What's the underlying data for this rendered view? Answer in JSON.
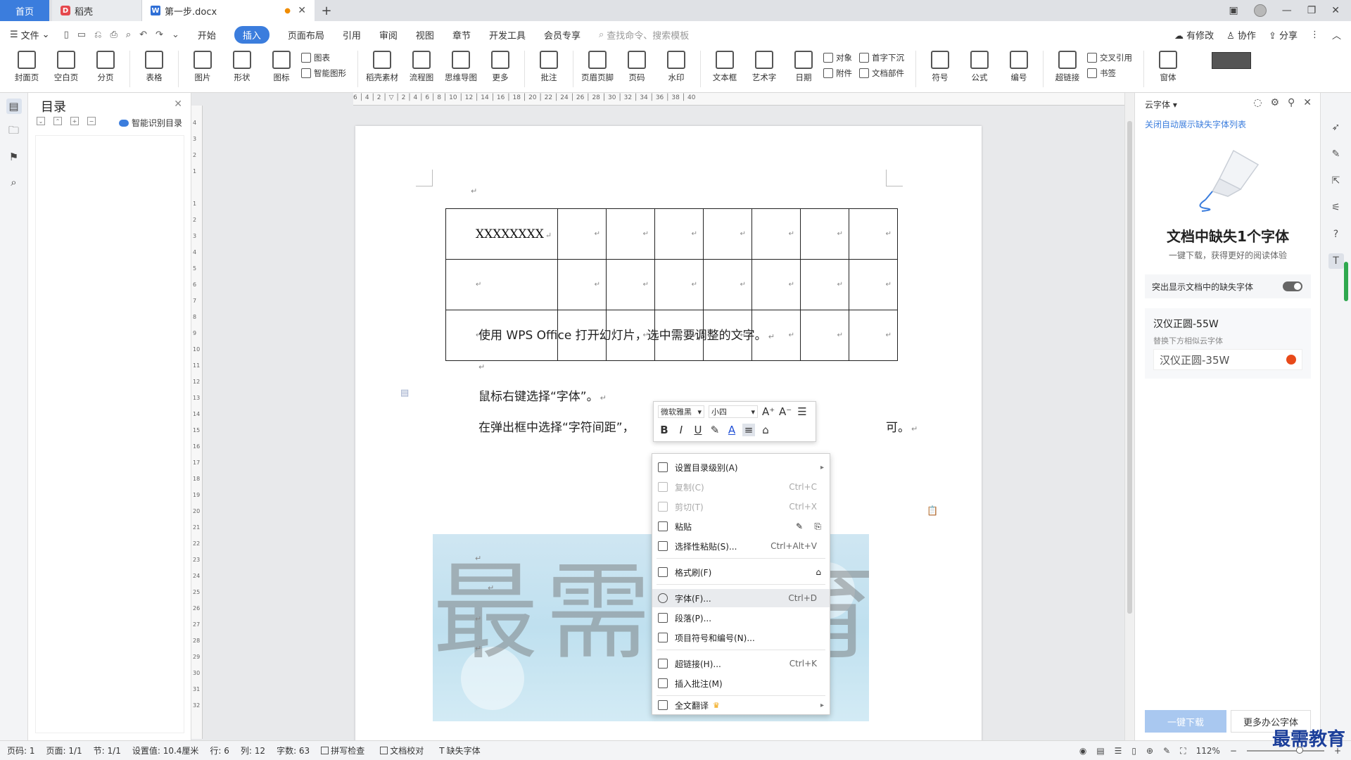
{
  "titlebar": {
    "tab_home": "首页",
    "tab_daoke": "稻壳",
    "tab_doc": "第一步.docx",
    "tab_add": "+"
  },
  "menubar": {
    "file": "文件",
    "items": [
      "开始",
      "插入",
      "页面布局",
      "引用",
      "审阅",
      "视图",
      "章节",
      "开发工具",
      "会员专享"
    ],
    "active_index": 1,
    "search": "查找命令、搜索模板",
    "right": [
      "有修改",
      "协作",
      "分享"
    ]
  },
  "ribbon": {
    "big": [
      {
        "label": "封面页"
      },
      {
        "label": "空白页"
      },
      {
        "label": "分页"
      },
      {
        "label": "表格"
      },
      {
        "label": "图片"
      },
      {
        "label": "形状"
      },
      {
        "label": "图标"
      }
    ],
    "small_a": [
      "图表",
      "智能图形"
    ],
    "big2": [
      {
        "label": "稻壳素材"
      },
      {
        "label": "流程图"
      },
      {
        "label": "思维导图"
      },
      {
        "label": "更多"
      },
      {
        "label": "批注"
      },
      {
        "label": "页眉页脚"
      },
      {
        "label": "页码"
      },
      {
        "label": "水印"
      },
      {
        "label": "文本框"
      },
      {
        "label": "艺术字"
      },
      {
        "label": "日期"
      }
    ],
    "small_b": [
      "对象",
      "附件"
    ],
    "small_c": [
      "首字下沉",
      "文档部件"
    ],
    "big3": [
      {
        "label": "符号"
      },
      {
        "label": "公式"
      },
      {
        "label": "编号"
      },
      {
        "label": "超链接"
      }
    ],
    "small_d": [
      "交叉引用",
      "书签"
    ],
    "big4": [
      {
        "label": "窗体"
      }
    ]
  },
  "toc": {
    "title": "目录",
    "smart": "智能识别目录"
  },
  "ruler": {
    "h": "6 │ 4 │ 2 │ ▽ │ 2 │ 4 │ 6 │ 8 │ 10 │ 12 │ 14 │ 16 │ 18 │ 20 │ 22 │ 24 │ 26 │ 28 │ 30 │ 32 │ 34 │ 36 │ 38 │ 40",
    "v": [
      "4",
      "3",
      "2",
      "1",
      "",
      "1",
      "2",
      "3",
      "4",
      "5",
      "6",
      "7",
      "8",
      "9",
      "10",
      "11",
      "12",
      "13",
      "14",
      "15",
      "16",
      "17",
      "18",
      "19",
      "20",
      "21",
      "22",
      "23",
      "24",
      "25",
      "26",
      "27",
      "28",
      "29",
      "30",
      "31",
      "32"
    ]
  },
  "document": {
    "table_title": "XXXXXXXX",
    "para1": "使用 WPS Office 打开幻灯片，选中需要调整的文字。",
    "para2": "鼠标右键选择“字体”。",
    "para3_start": "在弹出框中选择“字符间距”，",
    "para3_end": "可。",
    "para_mark": "↵",
    "watermark": "最需教育"
  },
  "minitoolbar": {
    "font": "微软雅黑",
    "size": "小四",
    "bold": "B",
    "italic": "I",
    "underline": "U",
    "font_color": "A"
  },
  "contextmenu": {
    "items": [
      {
        "label": "设置目录级别(A)",
        "shortcut": "",
        "arrow": true
      },
      {
        "label": "复制(C)",
        "shortcut": "Ctrl+C",
        "disabled": true
      },
      {
        "label": "剪切(T)",
        "shortcut": "Ctrl+X",
        "disabled": true
      },
      {
        "label": "粘贴",
        "shortcut": ""
      },
      {
        "label": "选择性粘贴(S)...",
        "shortcut": "Ctrl+Alt+V"
      },
      {
        "label": "格式刷(F)",
        "shortcut": ""
      },
      {
        "label": "字体(F)...",
        "shortcut": "Ctrl+D",
        "highlight": true
      },
      {
        "label": "段落(P)...",
        "shortcut": ""
      },
      {
        "label": "项目符号和编号(N)...",
        "shortcut": ""
      },
      {
        "label": "超链接(H)...",
        "shortcut": "Ctrl+K"
      },
      {
        "label": "插入批注(M)",
        "shortcut": ""
      },
      {
        "label": "全文翻译",
        "shortcut": "",
        "arrow": true,
        "crown": true
      }
    ]
  },
  "rightpanel": {
    "title": "云字体",
    "link": "关闭自动展示缺失字体列表",
    "heading": "文档中缺失1个字体",
    "sub": "一键下载，获得更好的阅读体验",
    "toggle_label": "突出显示文档中的缺失字体",
    "font_name": "汉仪正圆-55W",
    "font_hint": "替换下方相似云字体",
    "font_alt": "汉仪正圆-35W",
    "btn_download": "一键下载",
    "btn_more": "更多办公字体"
  },
  "statusbar": {
    "items": [
      "页码: 1",
      "页面: 1/1",
      "节: 1/1",
      "设置值: 10.4厘米",
      "行: 6",
      "列: 12",
      "字数: 63"
    ],
    "check1": "拼写检查",
    "check2": "文档校对",
    "missing_font": "缺失字体",
    "zoom": "112%"
  },
  "brand": "最需教育",
  "colors": {
    "accent": "#3b7ddd",
    "toggle": "#666666",
    "badge": "#e84a1a"
  }
}
